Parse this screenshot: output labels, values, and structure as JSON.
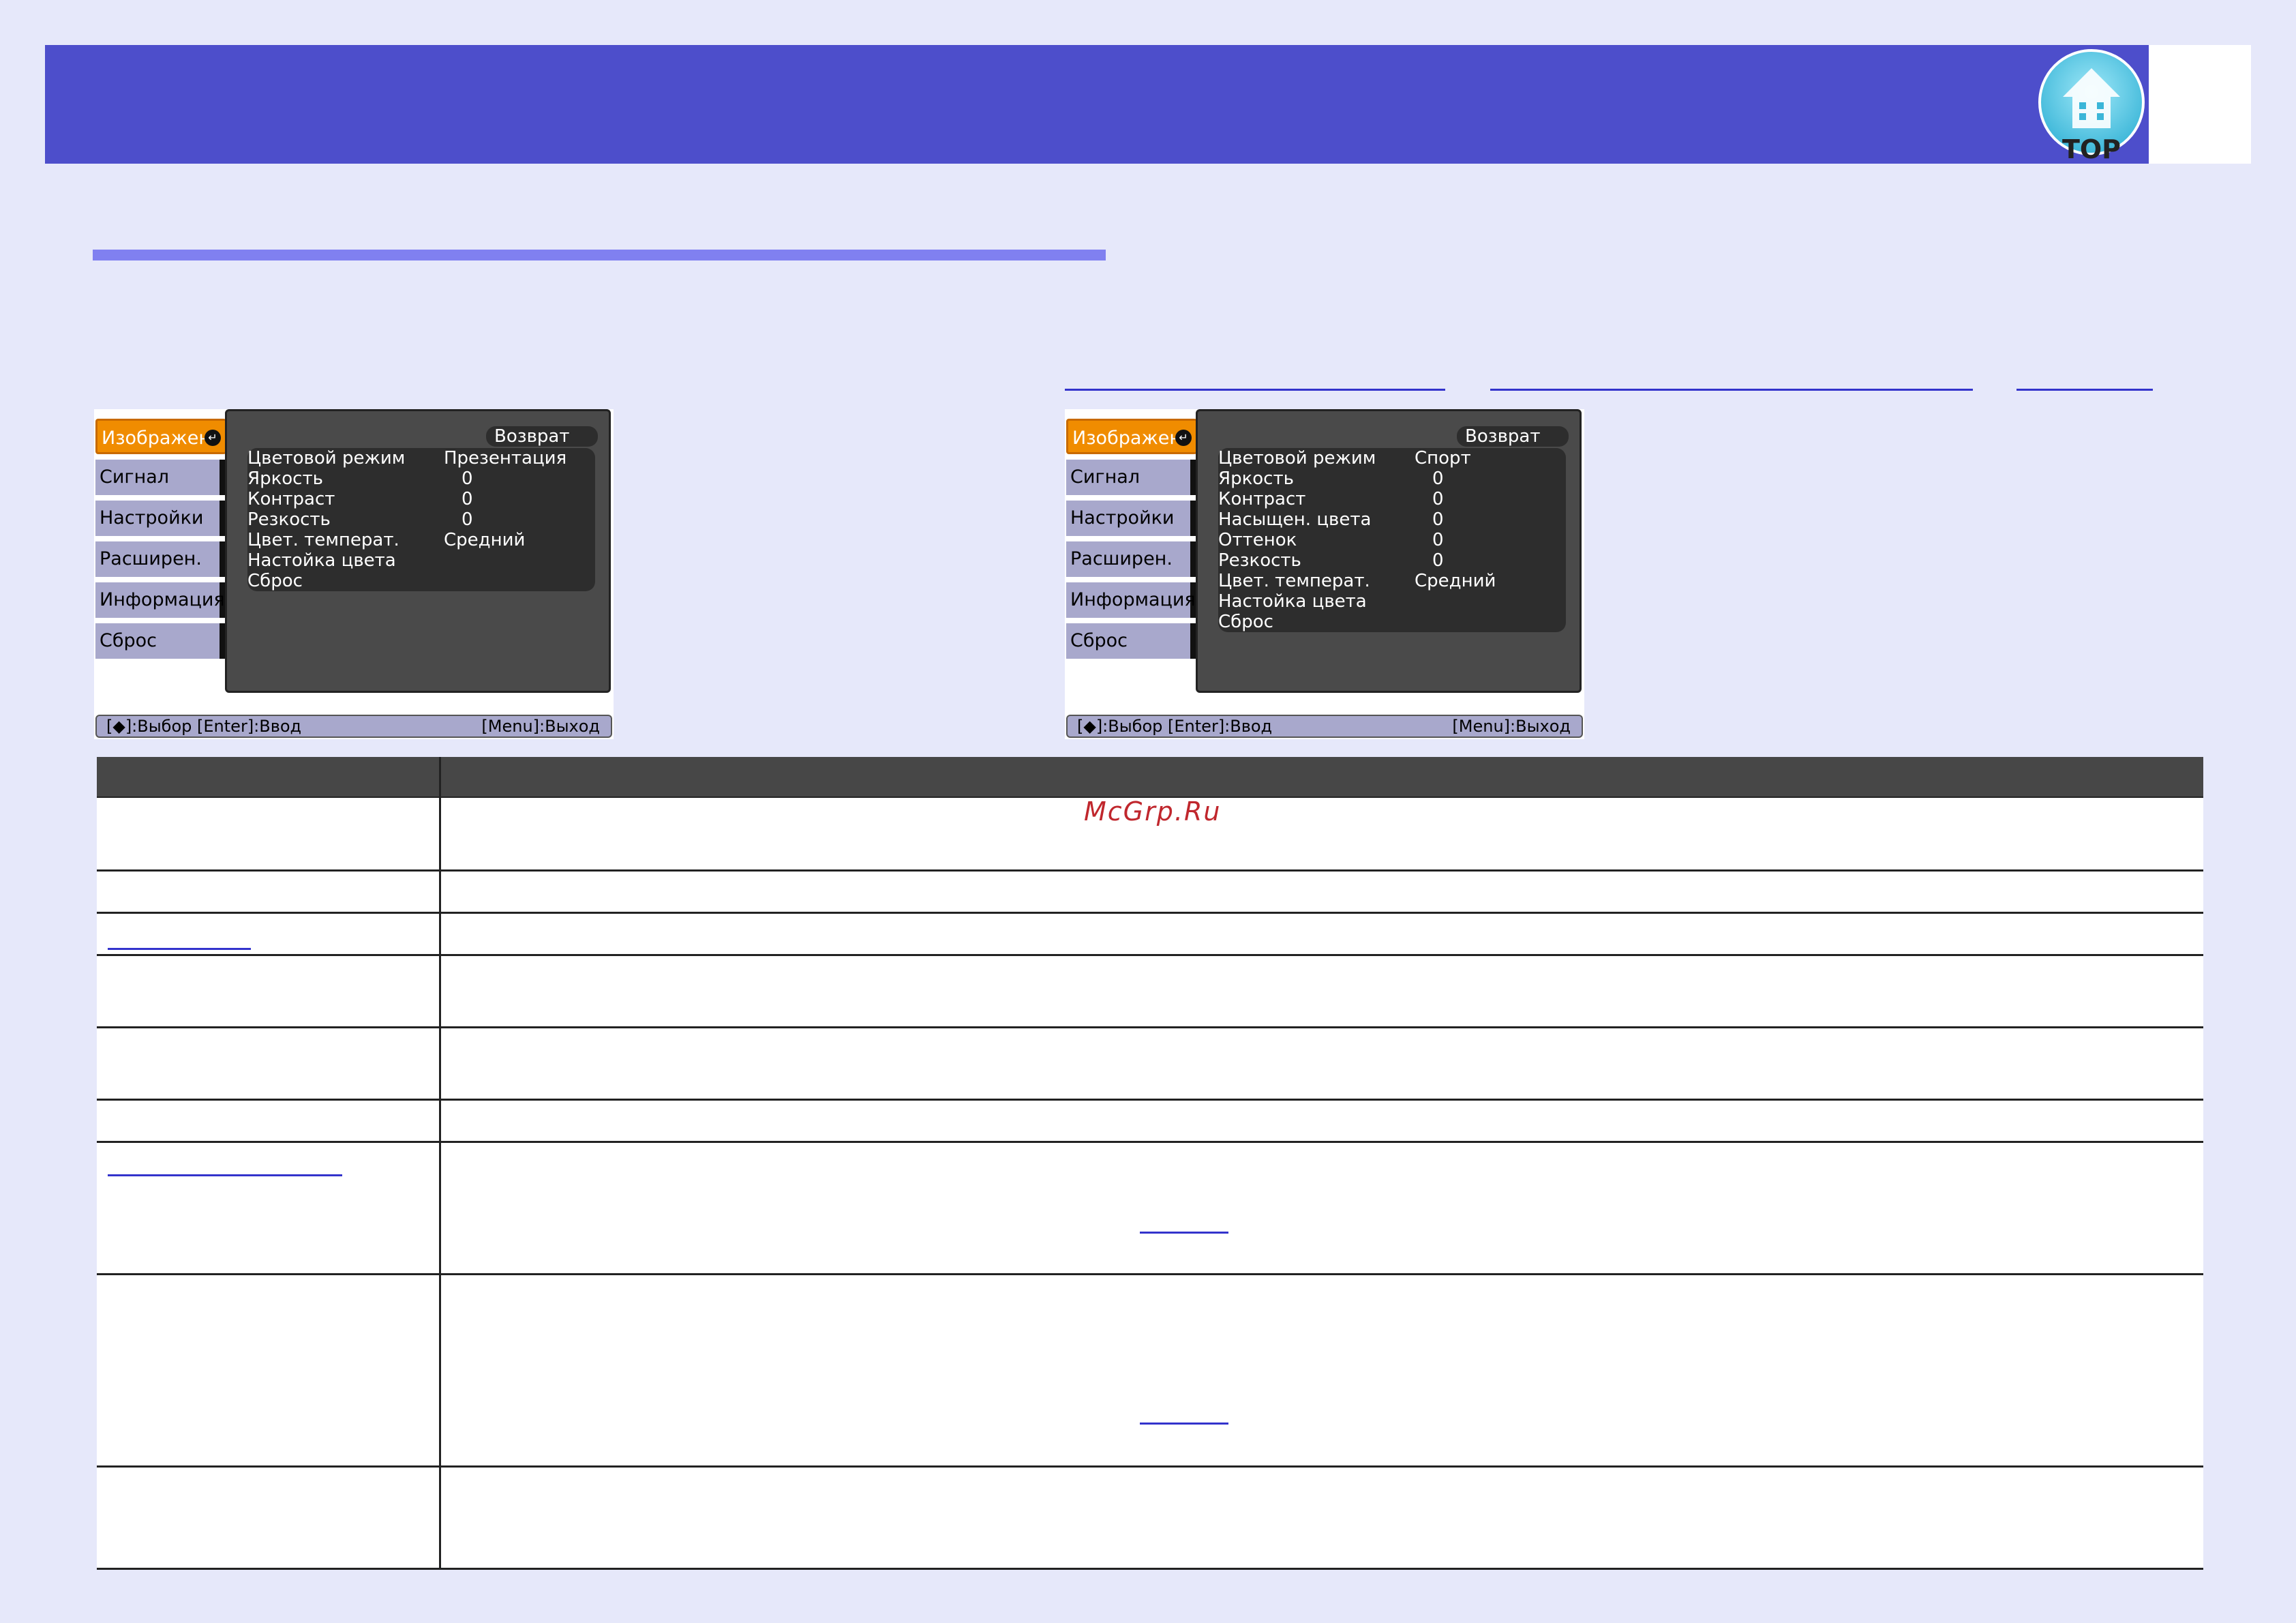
{
  "header": {
    "logo_label": "TOP"
  },
  "menu_left": {
    "sidebar": [
      "Изображен.",
      "Сигнал",
      "Настройки",
      "Расширен.",
      "Информация",
      "Сброс"
    ],
    "back_label": "Возврат",
    "rows": [
      {
        "label": "Цветовой режим",
        "value": "Презентация"
      },
      {
        "label": "Яркость",
        "value": "0"
      },
      {
        "label": "Контраст",
        "value": "0"
      },
      {
        "label": "Резкость",
        "value": "0"
      },
      {
        "label": "Цвет. температ.",
        "value": "Средний"
      },
      {
        "label": "Настойка цвета",
        "value": ""
      },
      {
        "label": "Сброс",
        "value": ""
      }
    ],
    "status_left": "[◆]:Выбор  [Enter]:Ввод",
    "status_right": "[Menu]:Выход"
  },
  "menu_right": {
    "sidebar": [
      "Изображен.",
      "Сигнал",
      "Настройки",
      "Расширен.",
      "Информация",
      "Сброс"
    ],
    "back_label": "Возврат",
    "rows": [
      {
        "label": "Цветовой режим",
        "value": "Спорт"
      },
      {
        "label": "Яркость",
        "value": "0"
      },
      {
        "label": "Контраст",
        "value": "0"
      },
      {
        "label": "Насыщен. цвета",
        "value": "0"
      },
      {
        "label": "Оттенок",
        "value": "0"
      },
      {
        "label": "Резкость",
        "value": "0"
      },
      {
        "label": "Цвет. температ.",
        "value": "Средний"
      },
      {
        "label": "Настойка цвета",
        "value": ""
      },
      {
        "label": "Сброс",
        "value": ""
      }
    ],
    "status_left": "[◆]:Выбор  [Enter]:Ввод",
    "status_right": "[Menu]:Выход"
  },
  "watermark": "McGrp.Ru",
  "colors": {
    "background": "#e6e8fa",
    "header": "#4d4ecb",
    "accent_rule": "#8080f0",
    "active_tab": "#f08c00",
    "link": "#3333cc"
  }
}
